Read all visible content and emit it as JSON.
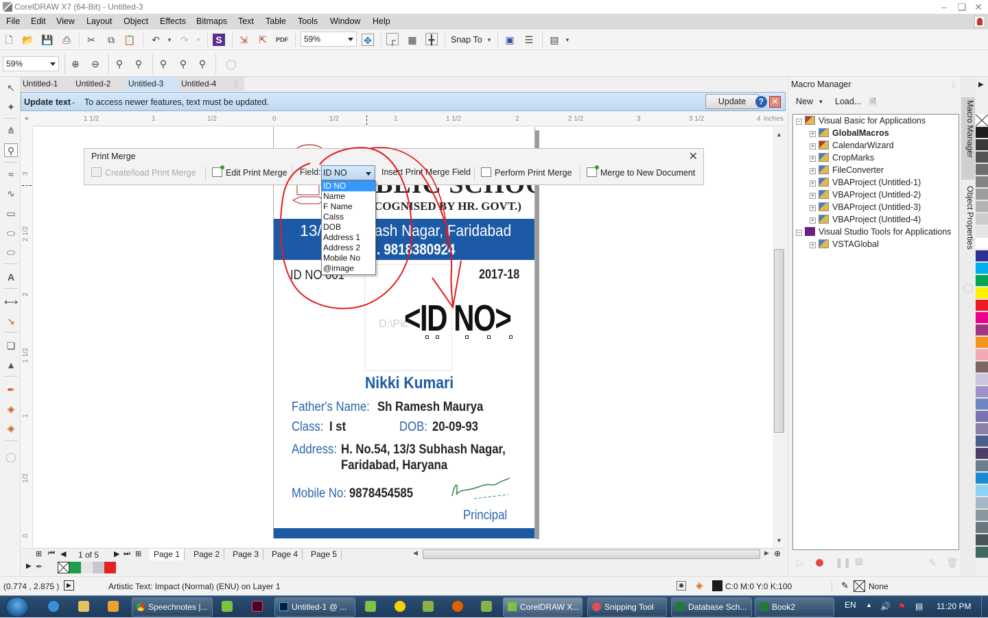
{
  "app": {
    "title": "CorelDRAW X7 (64-Bit) - Untitled-3"
  },
  "menu": [
    "File",
    "Edit",
    "View",
    "Layout",
    "Object",
    "Effects",
    "Bitmaps",
    "Text",
    "Table",
    "Tools",
    "Window",
    "Help"
  ],
  "toolbar": {
    "zoom_level": "59%",
    "zoom_level2": "59%",
    "snap_to": "Snap To"
  },
  "doc_tabs": [
    "Untitled-1",
    "Untitled-2",
    "Untitled-3",
    "Untitled-4"
  ],
  "active_doc_tab": "Untitled-3",
  "infobar": {
    "title": "Update text",
    "dash": "-",
    "message": "To access newer features, text must be updated.",
    "update_label": "Update",
    "help": "?"
  },
  "ruler": {
    "h_ticks": [
      "1 1/2",
      "1",
      "1/2",
      "0",
      "1/2",
      "1",
      "1 1/2",
      "2",
      "2 1/2",
      "3",
      "3 1/2",
      "4"
    ],
    "h_unit": "inches",
    "v_ticks": [
      "3",
      "2 1/2",
      "2",
      "1 1/2",
      "1",
      "1/2",
      "0"
    ],
    "v_unit": "inches"
  },
  "print_merge": {
    "title": "Print Merge",
    "create_load": "Create/load Print Merge",
    "edit": "Edit Print Merge",
    "field_label": "Field:",
    "field_value": "ID NO",
    "insert_field": "Insert Print Merge Field",
    "perform": "Perform Print Merge",
    "merge_new": "Merge to New Document",
    "close": "✕",
    "field_options": [
      "ID NO",
      "Name",
      "F Name",
      "Calss",
      "DOB",
      "Address 1",
      "Address 2",
      "Mobile No",
      "@image"
    ],
    "selected_option": "ID NO"
  },
  "id_card": {
    "school_partial": "BLIC SCHOOL",
    "recognised": "COGNISED BY HR. GOVT.)",
    "address_line": "13/3 Subhash Nagar, Faridabad",
    "address_partial": "ash Nagar, Faridabad",
    "address_prefix": "13/",
    "phone_partial": ". 9818380924",
    "id_no_label": "ID NO 001",
    "session": "2017-18",
    "merge_field": "<ID NO>",
    "photo_path_partial": "D:\\Pic",
    "name": "Nikki Kumari",
    "father_label": "Father's Name:",
    "father_value": "Sh Ramesh Maurya",
    "class_label": "Class:",
    "class_value": "I st",
    "dob_label": "DOB:",
    "dob_value": "20-09-93",
    "address_label": "Address:",
    "address_value1": "H. No.54, 13/3 Subhash Nagar,",
    "address_value2": "Faridabad, Haryana",
    "mobile_label": "Mobile No:",
    "mobile_value": "9878454585",
    "principal": "Principal",
    "brand_blue": "#1c5aa6"
  },
  "page_nav": {
    "counter": "1 of 5",
    "pages": [
      "Page 1",
      "Page 2",
      "Page 3",
      "Page 4",
      "Page 5"
    ],
    "active_page": "Page 1"
  },
  "doc_palette": [
    "none",
    "#1e9e4a",
    "#e6e6e6",
    "#c8c8c8",
    "#e52222"
  ],
  "status": {
    "coords": "(0.774 , 2.875 )",
    "object_info": "Artistic Text: Impact (Normal) (ENU) on Layer 1",
    "fill": "C:0 M:0 Y:0 K:100",
    "outline": "None"
  },
  "macro_manager": {
    "title": "Macro Manager",
    "new_label": "New",
    "load_label": "Load...",
    "tree": [
      {
        "label": "Visual Basic for Applications",
        "level": 0,
        "expanded": true
      },
      {
        "label": "GlobalMacros",
        "level": 1,
        "bold": true
      },
      {
        "label": "CalendarWizard",
        "level": 1
      },
      {
        "label": "CropMarks",
        "level": 1
      },
      {
        "label": "FileConverter",
        "level": 1
      },
      {
        "label": "VBAProject (Untitled-1)",
        "level": 1
      },
      {
        "label": "VBAProject (Untitled-2)",
        "level": 1
      },
      {
        "label": "VBAProject (Untitled-3)",
        "level": 1
      },
      {
        "label": "VBAProject (Untitled-4)",
        "level": 1
      },
      {
        "label": "Visual Studio Tools for Applications",
        "level": 0,
        "expanded": true
      },
      {
        "label": "VSTAGlobal",
        "level": 1
      }
    ]
  },
  "side_tabs": [
    "Macro Manager",
    "Object Properties"
  ],
  "color_palette": [
    "none",
    "#1e1e1e",
    "#3a3a3a",
    "#555555",
    "#6e6e6e",
    "#858585",
    "#9c9c9c",
    "#b3b3b3",
    "#cccccc",
    "#e4e4e4",
    "#ffffff",
    "#2e3192",
    "#00aeef",
    "#00a651",
    "#fff200",
    "#ed1c24",
    "#ec008c",
    "#a3357f",
    "#f7941d",
    "#f4a8b0",
    "#7d6660",
    "#c9c4e0",
    "#9c92c9",
    "#6f86c2",
    "#7b72b3",
    "#8a7fa8",
    "#4b5e8f",
    "#4d4068",
    "#6a7f8e",
    "#1a8ad4",
    "#8dd3f7",
    "#a2b7c8",
    "#88989e",
    "#687880",
    "#4a555c",
    "#3f6b5f"
  ],
  "taskbar": {
    "items": [
      "Speechnotes |...",
      "Untitled-1 @ ...",
      "CorelDRAW X...",
      "Snipping Tool",
      "Database Sch...",
      "Book2"
    ],
    "lang": "EN",
    "time": "11:20 PM"
  }
}
